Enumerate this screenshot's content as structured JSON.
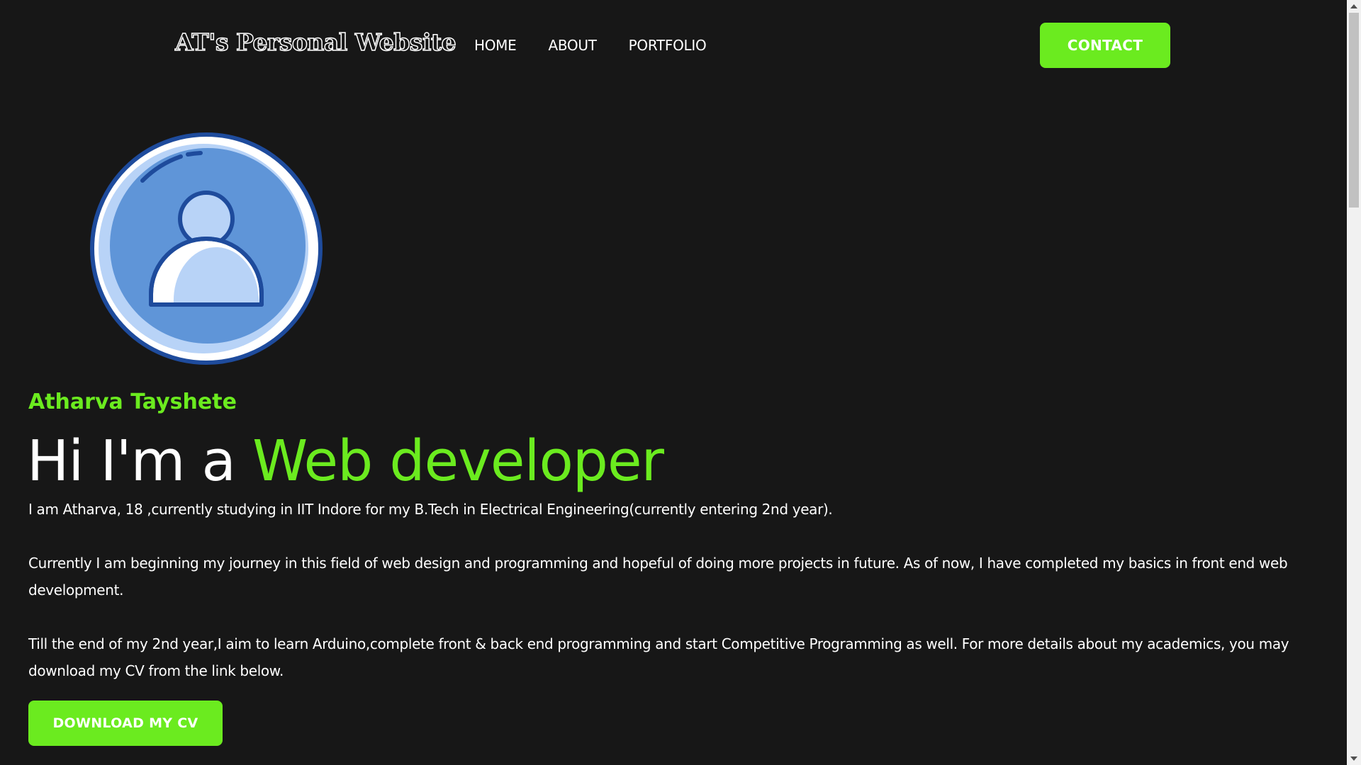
{
  "header": {
    "logo_text": "AT's Personal Website",
    "nav": [
      {
        "label": "HOME"
      },
      {
        "label": "ABOUT"
      },
      {
        "label": "PORTFOLIO"
      }
    ],
    "contact_label": "CONTACT"
  },
  "hero": {
    "avatar_icon": "user-avatar-icon",
    "name": "Atharva Tayshete",
    "headline_prefix": "Hi I'm a ",
    "headline_accent": "Web developer",
    "paragraphs": [
      "I am Atharva, 18 ,currently studying in IIT Indore for my B.Tech in Electrical Engineering(currently entering 2nd year).",
      "Currently I am beginning my journey in this field of web design and programming and hopeful of doing more projects in future. As of now, I have completed my basics in front end web development.",
      "Till the end of my 2nd year,I aim to learn Arduino,complete front & back end programming and start Competitive Programming as well. For more details about my academics, you may download my CV from the link below."
    ],
    "cv_button_label": "DOWNLOAD MY CV"
  },
  "colors": {
    "background": "#171717",
    "accent": "#6beb1f",
    "text": "#ffffff"
  }
}
